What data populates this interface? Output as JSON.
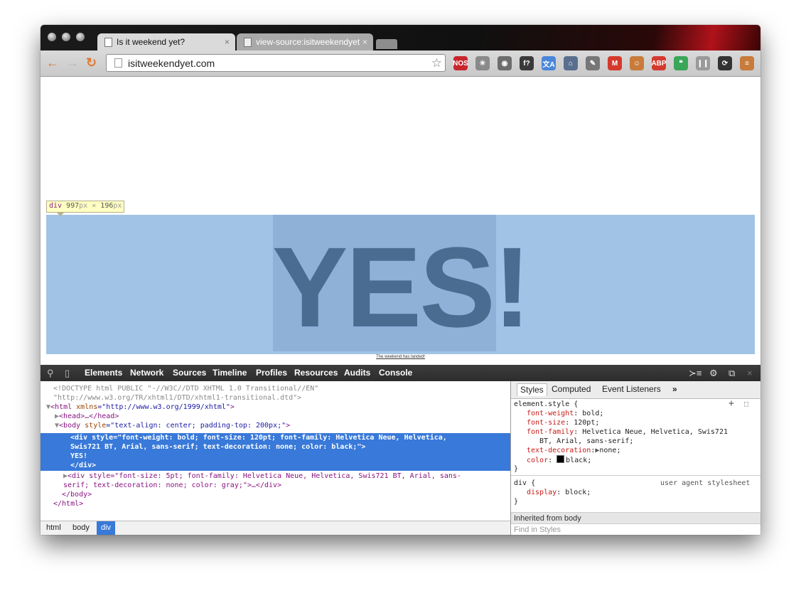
{
  "browser": {
    "tabs": [
      {
        "title": "Is it weekend yet?",
        "close": "×"
      },
      {
        "title": "view-source:isitweekendyet.c",
        "close": "×"
      }
    ],
    "url": "isitweekendyet.com",
    "nav": {
      "back": "←",
      "forward": "→",
      "reload": "↻"
    },
    "star": "☆",
    "extensions": [
      {
        "name": "nos-icon",
        "label": "NOS",
        "color": "#c8262d"
      },
      {
        "name": "spinner-icon",
        "label": "✳",
        "color": "#8a8a8a"
      },
      {
        "name": "eye-icon",
        "label": "◉",
        "color": "#6d6d6d"
      },
      {
        "name": "function-icon",
        "label": "f?",
        "color": "#3a3a3a"
      },
      {
        "name": "translate-icon",
        "label": "文A",
        "color": "#4a86d9"
      },
      {
        "name": "house-mail-icon",
        "label": "⌂",
        "color": "#5a6f8f"
      },
      {
        "name": "pen-icon",
        "label": "✎",
        "color": "#777777"
      },
      {
        "name": "gmail-icon",
        "label": "M",
        "color": "#d33a2c"
      },
      {
        "name": "face-icon",
        "label": "☺",
        "color": "#c87b3a"
      },
      {
        "name": "adblock-icon",
        "label": "ABP",
        "color": "#d43a2f"
      },
      {
        "name": "hangouts-icon",
        "label": "❝",
        "color": "#3aa659"
      },
      {
        "name": "book-icon",
        "label": "❙❙",
        "color": "#9a9a9a"
      },
      {
        "name": "sync-icon",
        "label": "⟳",
        "color": "#333333"
      },
      {
        "name": "menu-icon",
        "label": "≡",
        "color": "#c87b3a"
      }
    ]
  },
  "page": {
    "headline": "YES!",
    "footer_link": "The weekend has landed!",
    "inspect_tooltip": {
      "tag": "div",
      "width": "997",
      "height": "196",
      "unit": "px",
      "times": "×"
    }
  },
  "devtools": {
    "panels": [
      "Elements",
      "Network",
      "Sources",
      "Timeline",
      "Profiles",
      "Resources",
      "Audits",
      "Console"
    ],
    "dom": {
      "doctype1": "<!DOCTYPE html PUBLIC \"-//W3C//DTD XHTML 1.0 Transitional//EN\"",
      "doctype2": "\"http://www.w3.org/TR/xhtml1/DTD/xhtml1-transitional.dtd\">",
      "html_open_tag": "<html",
      "html_attr": " xmlns",
      "html_val": "=\"http://www.w3.org/1999/xhtml\"",
      "html_close": ">",
      "head": "<head>…</head>",
      "body_open_tag": "<body",
      "body_attr": " style",
      "body_val": "=\"text-align: center; padding-top: 200px;\"",
      "body_close": ">",
      "div_line1": "<div style=\"font-weight: bold; font-size: 120pt; font-family: Helvetica Neue, Helvetica,",
      "div_line2": "Swis721 BT, Arial, sans-serif; text-decoration: none; color: black;\">",
      "div_text": "YES!",
      "div_end": "</div>",
      "div2_line1": "<div style=\"font-size: 5pt; font-family: Helvetica Neue, Helvetica, Swis721 BT, Arial, sans-",
      "div2_line2": "serif; text-decoration: none; color: gray;\">…</div>",
      "body_end": "</body>",
      "html_end": "</html>"
    },
    "breadcrumbs": [
      "html",
      "body",
      "div"
    ],
    "styles": {
      "tabs": [
        "Styles",
        "Computed",
        "Event Listeners"
      ],
      "more": "»",
      "element_selector": "element.style {",
      "rules": [
        {
          "prop": "font-weight",
          "value": "bold;"
        },
        {
          "prop": "font-size",
          "value": "120pt;"
        },
        {
          "prop": "font-family",
          "value": "Helvetica Neue, Helvetica, Swis721"
        },
        {
          "prop": "",
          "value": "BT, Arial, sans-serif;"
        },
        {
          "prop": "text-decoration",
          "value": "none;"
        },
        {
          "prop": "color",
          "value": "black;"
        }
      ],
      "close_brace": "}",
      "ua_selector": "div {",
      "ua_label": "user agent stylesheet",
      "ua_rule": {
        "prop": "display",
        "value": "block;"
      },
      "inherited": "Inherited from body",
      "find_placeholder": "Find in Styles"
    }
  }
}
